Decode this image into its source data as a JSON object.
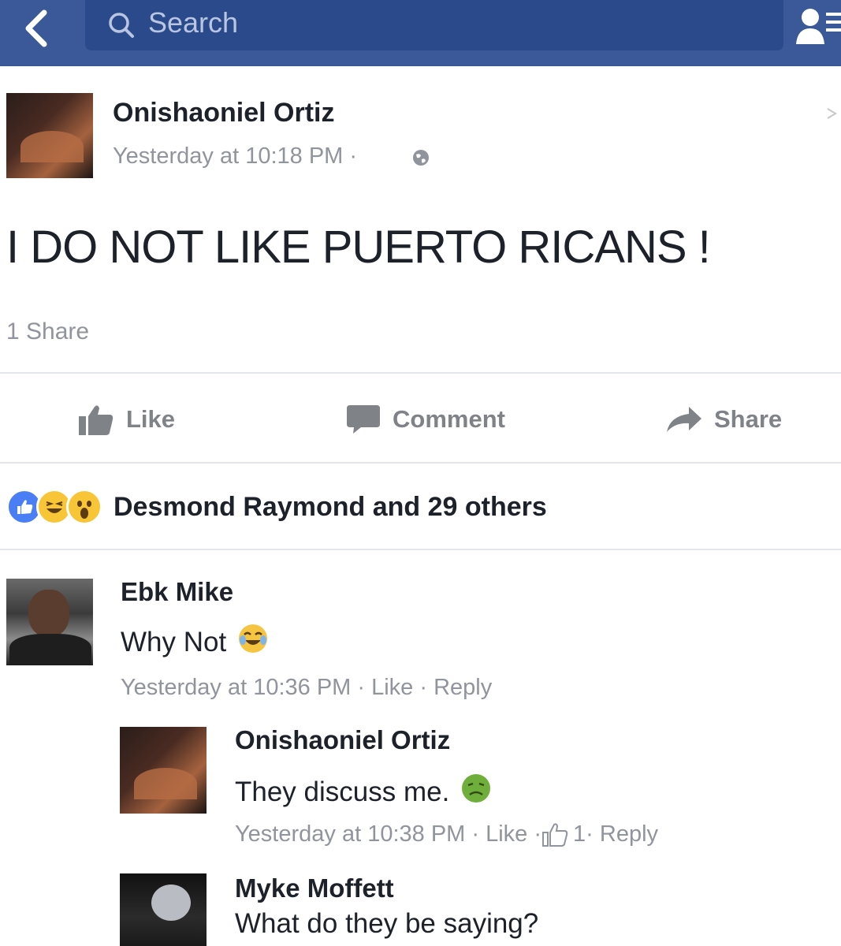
{
  "header": {
    "search_placeholder": "Search"
  },
  "post": {
    "author": "Onishaoniel Ortiz",
    "time": "Yesterday at 10:18 PM · ",
    "text": "I DO NOT LIKE  PUERTO RICANS !",
    "share_count": "1 Share"
  },
  "actions": {
    "like": "Like",
    "comment": "Comment",
    "share": "Share"
  },
  "reactions": {
    "summary": "Desmond Raymond and 29 others"
  },
  "comments": [
    {
      "author": "Ebk Mike",
      "text": "Why Not",
      "meta": "Yesterday at 10:36 PM · Like · Reply"
    },
    {
      "author": "Onishaoniel Ortiz",
      "text": "They discuss me.",
      "meta_prefix": "Yesterday at 10:38 PM · Like · ",
      "like_count": "1",
      "meta_suffix": " · Reply"
    },
    {
      "author": "Myke Moffett",
      "text": "What do they be saying?"
    }
  ],
  "colors": {
    "brand_blue": "#3b5998",
    "text_dark": "#1d2129",
    "text_gray": "#90949c"
  }
}
